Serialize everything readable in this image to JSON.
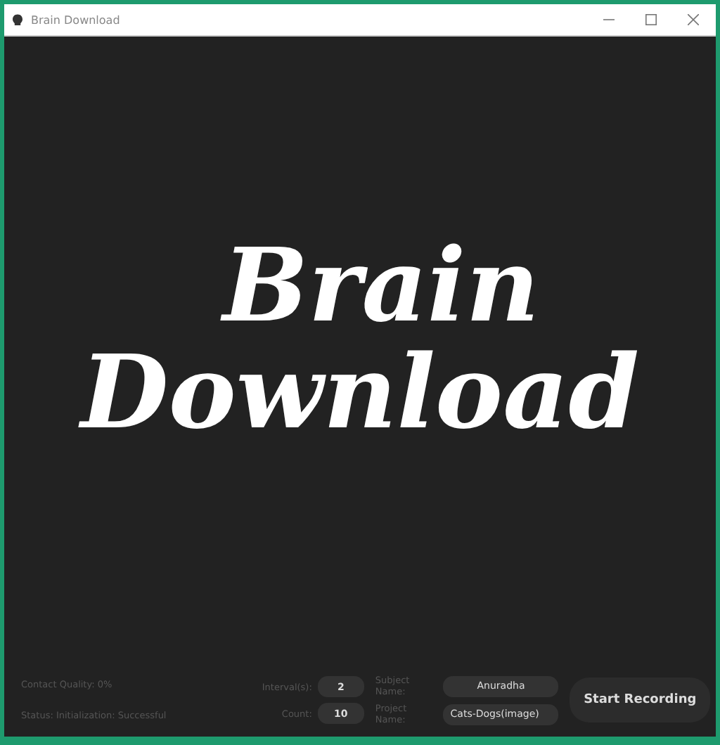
{
  "window": {
    "title": "Brain Download"
  },
  "logo": {
    "line_1": "Brain",
    "line_2": "Download"
  },
  "status": {
    "contact_quality": "Contact Quality: 0%",
    "status": "Status: Initialization: Successful"
  },
  "fields": [
    {
      "label": "Interval(s):",
      "value": "2"
    },
    {
      "label": "Count:",
      "value": "10"
    }
  ],
  "names": [
    {
      "label": "Subject Name:",
      "value": "Anuradha"
    },
    {
      "label": "Project Name:",
      "value": "Cats-Dogs(image)"
    }
  ],
  "start_button": "Start Recording"
}
